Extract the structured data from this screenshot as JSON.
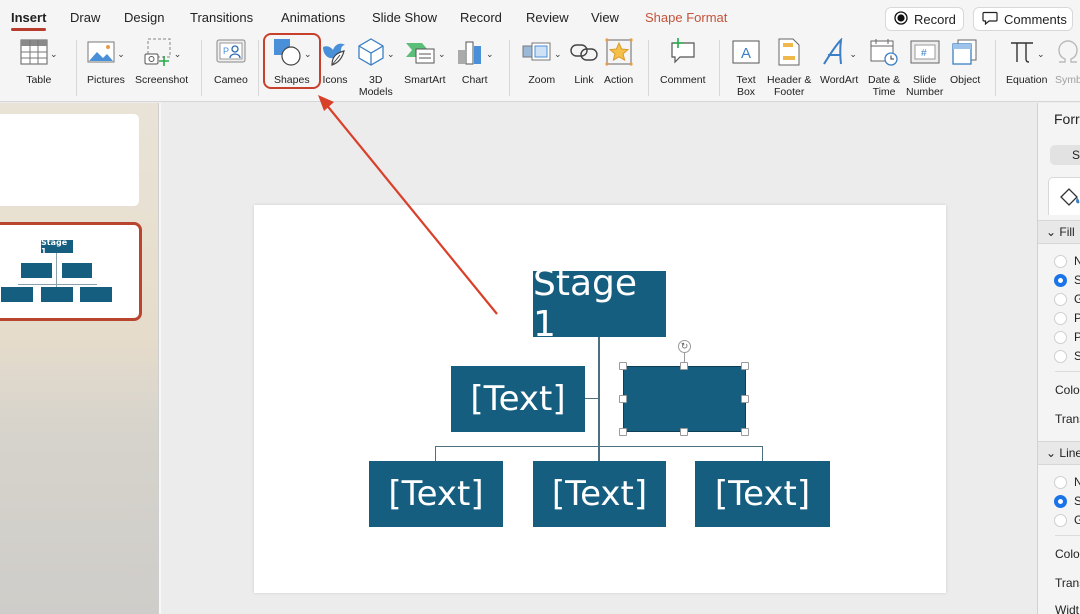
{
  "tabs": [
    {
      "label": "Insert",
      "state": "active"
    },
    {
      "label": "Draw"
    },
    {
      "label": "Design"
    },
    {
      "label": "Transitions"
    },
    {
      "label": "Animations"
    },
    {
      "label": "Slide Show"
    },
    {
      "label": "Record"
    },
    {
      "label": "Review"
    },
    {
      "label": "View"
    },
    {
      "label": "Shape Format",
      "state": "contextual"
    }
  ],
  "header_buttons": {
    "record": {
      "label": "Record",
      "icon": "record-icon"
    },
    "comments": {
      "label": "Comments",
      "icon": "comment-bubble-icon"
    }
  },
  "ribbon": {
    "items": [
      {
        "label": "Table",
        "icon": "table-icon",
        "dropdown": true
      },
      {
        "label": "Pictures",
        "icon": "pictures-icon",
        "dropdown": true
      },
      {
        "label": "Screenshot",
        "icon": "screenshot-icon",
        "dropdown": true
      },
      {
        "label": "Cameo",
        "icon": "cameo-icon"
      },
      {
        "label": "Shapes",
        "icon": "shapes-icon",
        "dropdown": true,
        "highlighted": true
      },
      {
        "label": "Icons",
        "icon": "icons-icon"
      },
      {
        "label": "3D\nModels",
        "icon": "3d-models-icon",
        "dropdown": true
      },
      {
        "label": "SmartArt",
        "icon": "smartart-icon",
        "dropdown": true
      },
      {
        "label": "Chart",
        "icon": "chart-icon",
        "dropdown": true
      },
      {
        "label": "Zoom",
        "icon": "zoom-icon",
        "dropdown": true
      },
      {
        "label": "Link",
        "icon": "link-icon"
      },
      {
        "label": "Action",
        "icon": "action-icon"
      },
      {
        "label": "Comment",
        "icon": "comment-add-icon"
      },
      {
        "label": "Text\nBox",
        "icon": "text-box-icon"
      },
      {
        "label": "Header &\nFooter",
        "icon": "header-footer-icon"
      },
      {
        "label": "WordArt",
        "icon": "wordart-icon",
        "dropdown": true
      },
      {
        "label": "Date &\nTime",
        "icon": "date-time-icon"
      },
      {
        "label": "Slide\nNumber",
        "icon": "slide-number-icon"
      },
      {
        "label": "Object",
        "icon": "object-icon"
      },
      {
        "label": "Equation",
        "icon": "equation-icon",
        "dropdown": true
      },
      {
        "label": "Symb",
        "icon": "symbol-icon",
        "disabled": true
      }
    ]
  },
  "thumbnails": [
    {
      "index": 1,
      "selected": false
    },
    {
      "index": 2,
      "selected": true,
      "title": "Stage 1"
    }
  ],
  "slide": {
    "top_box": "Stage 1",
    "mid_left_box": "[Text]",
    "mid_right_box": "",
    "bottom_boxes": [
      "[Text]",
      "[Text]",
      "[Text]"
    ],
    "selected_shape": "mid_right_box",
    "shape_fill": "#155e80"
  },
  "format_panel": {
    "title": "Forr",
    "segment_label": "S",
    "fill": {
      "section": "Fill",
      "options": [
        "N",
        "S",
        "G",
        "P",
        "P",
        "S"
      ],
      "selected_index": 1,
      "color_label": "Colo",
      "transparency_label": "Trans"
    },
    "line": {
      "section": "Line",
      "options": [
        "N",
        "S",
        "G"
      ],
      "selected_index": 1,
      "color_label": "Colo",
      "transparency_label": "Trans",
      "width_label": "Widt"
    }
  },
  "annotation": {
    "color": "#d9402a",
    "target": "Shapes"
  },
  "colors": {
    "accent": "#b83c2c",
    "contextual_tab": "#c4543a",
    "smartart_blue": "#155e80",
    "radio_blue": "#1a73e8"
  }
}
